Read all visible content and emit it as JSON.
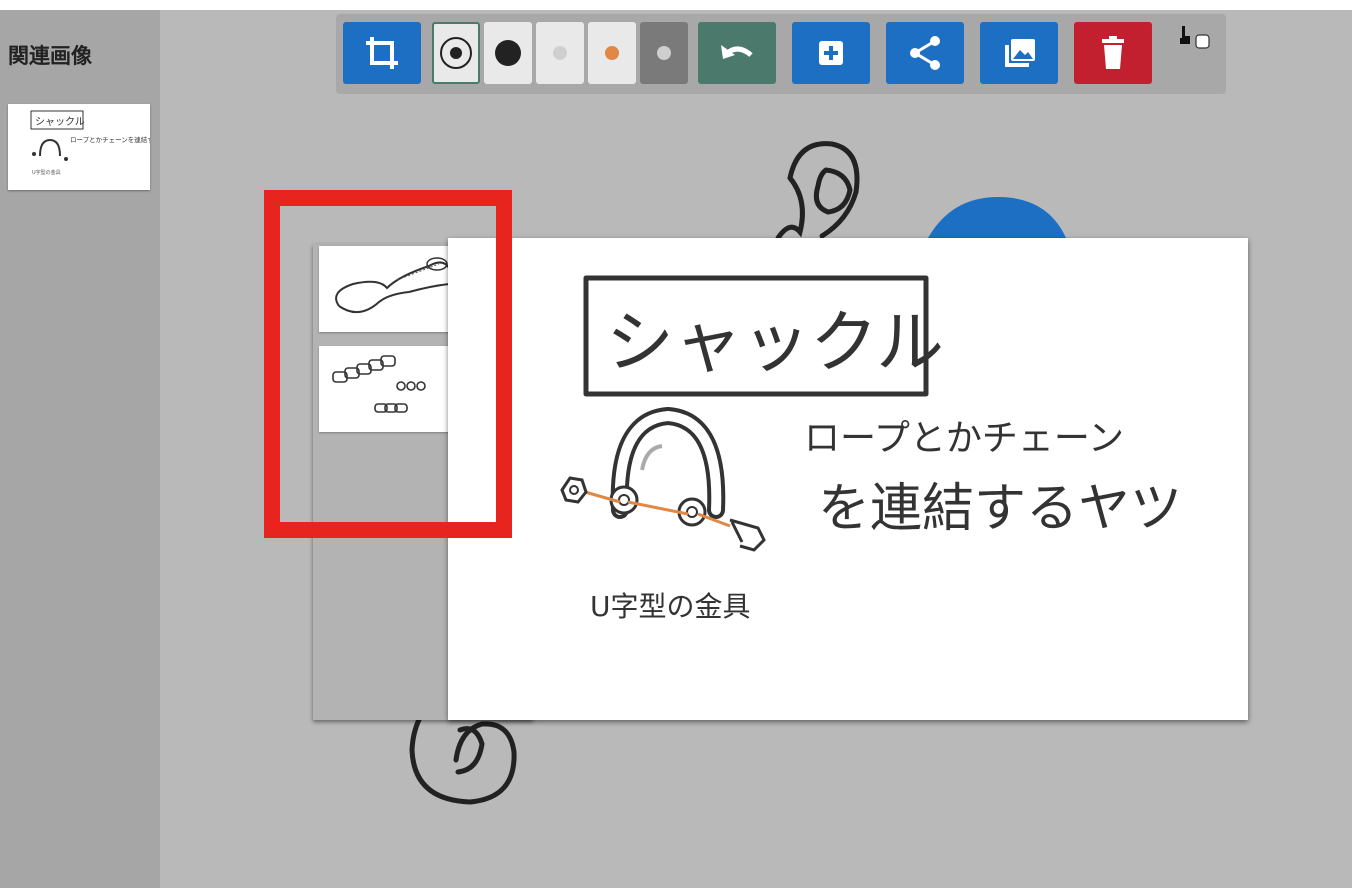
{
  "sidebar": {
    "title": "関連画像",
    "thumbnails": [
      {
        "title": "シャックル",
        "caption": "ロープとかチェーンを連結するヤツ",
        "note": "U字型の金具"
      }
    ]
  },
  "toolbar": {
    "buttons": [
      {
        "name": "crop-button",
        "icon": "crop-icon",
        "color": "#1d6fc4"
      },
      {
        "name": "undo-button",
        "icon": "undo-icon",
        "color": "#4b7a6d"
      },
      {
        "name": "add-button",
        "icon": "plus-icon",
        "color": "#1d6fc4"
      },
      {
        "name": "share-button",
        "icon": "share-icon",
        "color": "#1d6fc4"
      },
      {
        "name": "gallery-button",
        "icon": "image-icon",
        "color": "#1d6fc4"
      },
      {
        "name": "delete-button",
        "icon": "trash-icon",
        "color": "#c2202e"
      }
    ],
    "brushes": [
      {
        "name": "brush-large-black",
        "selected": true,
        "color": "#222222"
      },
      {
        "name": "brush-medium-black",
        "selected": false,
        "color": "#222222"
      },
      {
        "name": "brush-small-gray",
        "selected": false,
        "color": "#cfcfcf"
      },
      {
        "name": "brush-orange",
        "selected": false,
        "color": "#e08844"
      },
      {
        "name": "brush-gray",
        "selected": false,
        "color": "#cfcfcf"
      }
    ],
    "touch_mode_checked": false
  },
  "main_card": {
    "title": "シャックル",
    "caption_line1": "ロープとかチェーン",
    "caption_line2": "を連結するヤツ",
    "note": "U字型の金具"
  },
  "stack": {
    "thumbnails": [
      {
        "name": "rope-thumbnail"
      },
      {
        "name": "chain-thumbnail"
      }
    ]
  },
  "colors": {
    "accent_blue": "#1d6fc4",
    "highlight_red": "#e8241f",
    "delete_red": "#c2202e",
    "undo_teal": "#4b7a6d"
  }
}
